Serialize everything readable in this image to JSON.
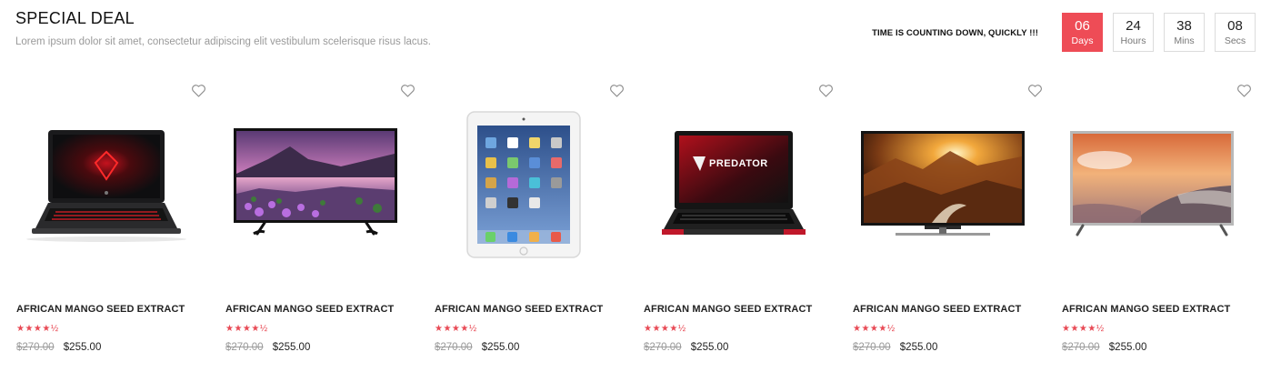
{
  "section": {
    "title": "SPECIAL DEAL",
    "subtitle": "Lorem ipsum dolor sit amet, consectetur adipiscing elit vestibulum scelerisque risus lacus."
  },
  "countdown": {
    "label": "TIME IS COUNTING DOWN, QUICKLY !!!",
    "units": [
      {
        "value": "06",
        "unit": "Days"
      },
      {
        "value": "24",
        "unit": "Hours"
      },
      {
        "value": "38",
        "unit": "Mins"
      },
      {
        "value": "08",
        "unit": "Secs"
      }
    ],
    "accent_color": "#ee4c56"
  },
  "products": [
    {
      "name": "AFRICAN MANGO SEED EXTRACT",
      "rating": "★★★★½",
      "old_price": "$270.00",
      "price": "$255.00",
      "image": "laptop-omen"
    },
    {
      "name": "AFRICAN MANGO SEED EXTRACT",
      "rating": "★★★★½",
      "old_price": "$270.00",
      "price": "$255.00",
      "image": "tv-lake"
    },
    {
      "name": "AFRICAN MANGO SEED EXTRACT",
      "rating": "★★★★½",
      "old_price": "$270.00",
      "price": "$255.00",
      "image": "tablet"
    },
    {
      "name": "AFRICAN MANGO SEED EXTRACT",
      "rating": "★★★★½",
      "old_price": "$270.00",
      "price": "$255.00",
      "image": "laptop-predator"
    },
    {
      "name": "AFRICAN MANGO SEED EXTRACT",
      "rating": "★★★★½",
      "old_price": "$270.00",
      "price": "$255.00",
      "image": "tv-canyon"
    },
    {
      "name": "AFRICAN MANGO SEED EXTRACT",
      "rating": "★★★★½",
      "old_price": "$270.00",
      "price": "$255.00",
      "image": "tv-coast"
    }
  ],
  "logo_text": {
    "predator": "PREDATOR"
  },
  "icons": {
    "wishlist": "heart-outline-icon"
  }
}
